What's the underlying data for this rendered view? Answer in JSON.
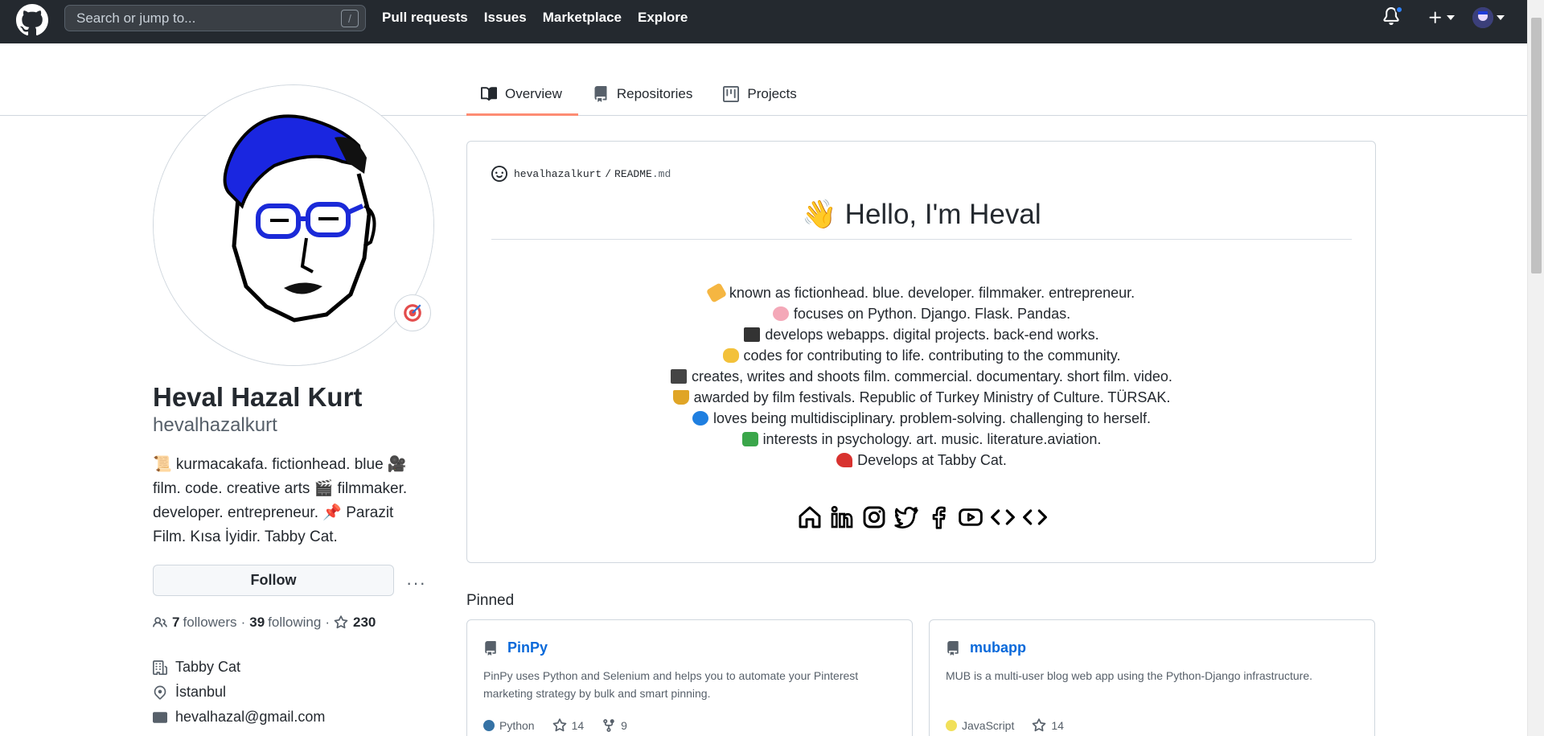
{
  "header": {
    "search_placeholder": "Search or jump to...",
    "search_key": "/",
    "nav": [
      "Pull requests",
      "Issues",
      "Marketplace",
      "Explore"
    ],
    "plus_icon": "plus-icon",
    "bell_icon": "bell-icon"
  },
  "tabs": [
    {
      "label": "Overview",
      "icon": "book-icon",
      "active": true
    },
    {
      "label": "Repositories",
      "icon": "repo-icon",
      "active": false
    },
    {
      "label": "Projects",
      "icon": "project-icon",
      "active": false
    }
  ],
  "profile": {
    "name": "Heval Hazal Kurt",
    "login": "hevalhazalkurt",
    "bio_1": "📜 kurmacakafa. fictionhead. blue 🎥",
    "bio_2": "film. code. creative arts 🎬 filmmaker.",
    "bio_3": "developer. entrepreneur. 📌 Parazit",
    "bio_4": "Film. Kısa İyidir. Tabby Cat.",
    "follow_label": "Follow",
    "more_label": "···",
    "followers_count": "7",
    "followers_label": "followers",
    "following_count": "39",
    "following_label": "following",
    "stars_count": "230",
    "company": "Tabby Cat",
    "location": "İstanbul",
    "email": "hevalhazal@gmail.com"
  },
  "readme": {
    "owner": "hevalhazalkurt",
    "separator": "/",
    "file": "README",
    "ext": ".md",
    "heading": "👋 Hello, I'm Heval",
    "lines": [
      "known as fictionhead. blue. developer. filmmaker. entrepreneur.",
      "focuses on Python. Django. Flask. Pandas.",
      "develops webapps. digital projects. back-end works.",
      "codes for contributing to life. contributing to the community.",
      "creates, writes and shoots film. commercial. documentary. short film. video.",
      "awarded by film festivals. Republic of Turkey Ministry of Culture. TÜRSAK.",
      "loves being multidisciplinary. problem-solving. challenging to herself.",
      "interests in psychology. art. music. literature.aviation.",
      "Develops at Tabby Cat."
    ]
  },
  "pinned": {
    "title": "Pinned",
    "cards": [
      {
        "name": "PinPy",
        "desc": "PinPy uses Python and Selenium and helps you to automate your Pinterest marketing strategy by bulk and smart pinning.",
        "lang": "Python",
        "lang_color": "#3572A5",
        "stars": "14",
        "forks": "9"
      },
      {
        "name": "mubapp",
        "desc": "MUB is a multi-user blog web app using the Python-Django infrastructure.",
        "lang": "JavaScript",
        "lang_color": "#f1e05a",
        "stars": "14"
      }
    ]
  }
}
